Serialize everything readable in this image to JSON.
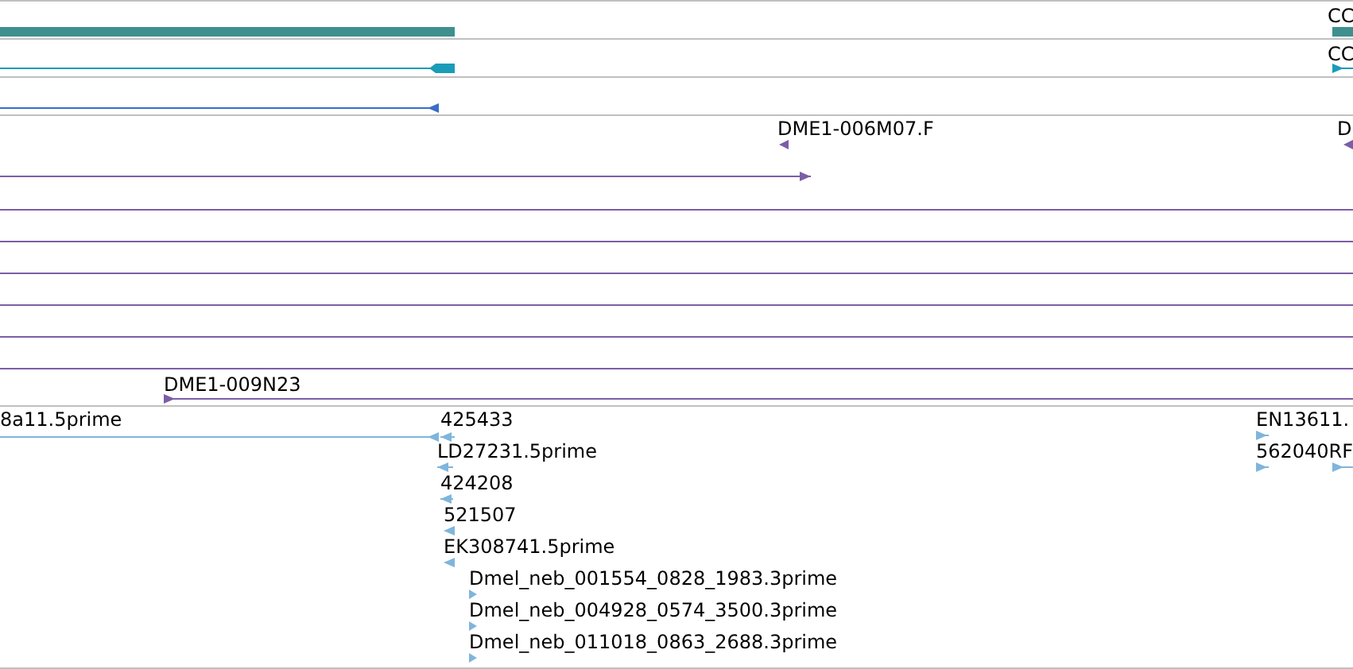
{
  "tracks": [
    {
      "color": "#3f8f8f",
      "features": [
        {
          "kind": "bar"
        },
        {
          "kind": "bar",
          "label": "CC"
        }
      ]
    },
    {
      "color": "#1a9cb8",
      "features": [
        {
          "kind": "block"
        },
        {
          "kind": "arrow-right",
          "label": "CC"
        }
      ]
    },
    {
      "color": "#3a6cc8",
      "features": [
        {
          "kind": "arrow-left"
        }
      ]
    },
    {
      "color": "#7b5ea7",
      "features": [
        {
          "kind": "arrow-left",
          "label": "DME1-006M07.F"
        },
        {
          "kind": "arrow-left",
          "label": "D"
        },
        {
          "kind": "arrow-right"
        },
        {
          "kind": "line"
        },
        {
          "kind": "line"
        },
        {
          "kind": "line"
        },
        {
          "kind": "line"
        },
        {
          "kind": "line"
        },
        {
          "kind": "line"
        },
        {
          "kind": "arrow-right",
          "label": "DME1-009N23"
        }
      ]
    },
    {
      "color": "#7fb5dc",
      "features": [
        {
          "kind": "arrow-left",
          "label": "8a11.5prime"
        },
        {
          "kind": "arrow-left",
          "label": "425433"
        },
        {
          "kind": "arrow-left",
          "label": "LD27231.5prime"
        },
        {
          "kind": "arrow-left",
          "label": "424208"
        },
        {
          "kind": "arrow-left",
          "label": "521507"
        },
        {
          "kind": "arrow-left",
          "label": "EK308741.5prime"
        },
        {
          "kind": "arrow-right",
          "label": "Dmel_neb_001554_0828_1983.3prime"
        },
        {
          "kind": "arrow-right",
          "label": "Dmel_neb_004928_0574_3500.3prime"
        },
        {
          "kind": "arrow-right",
          "label": "Dmel_neb_011018_0863_2688.3prime"
        },
        {
          "kind": "arrow-right",
          "label": "EN13611."
        },
        {
          "kind": "arrow-right",
          "label": "562040RF"
        },
        {
          "kind": "arrow-right"
        }
      ]
    }
  ]
}
